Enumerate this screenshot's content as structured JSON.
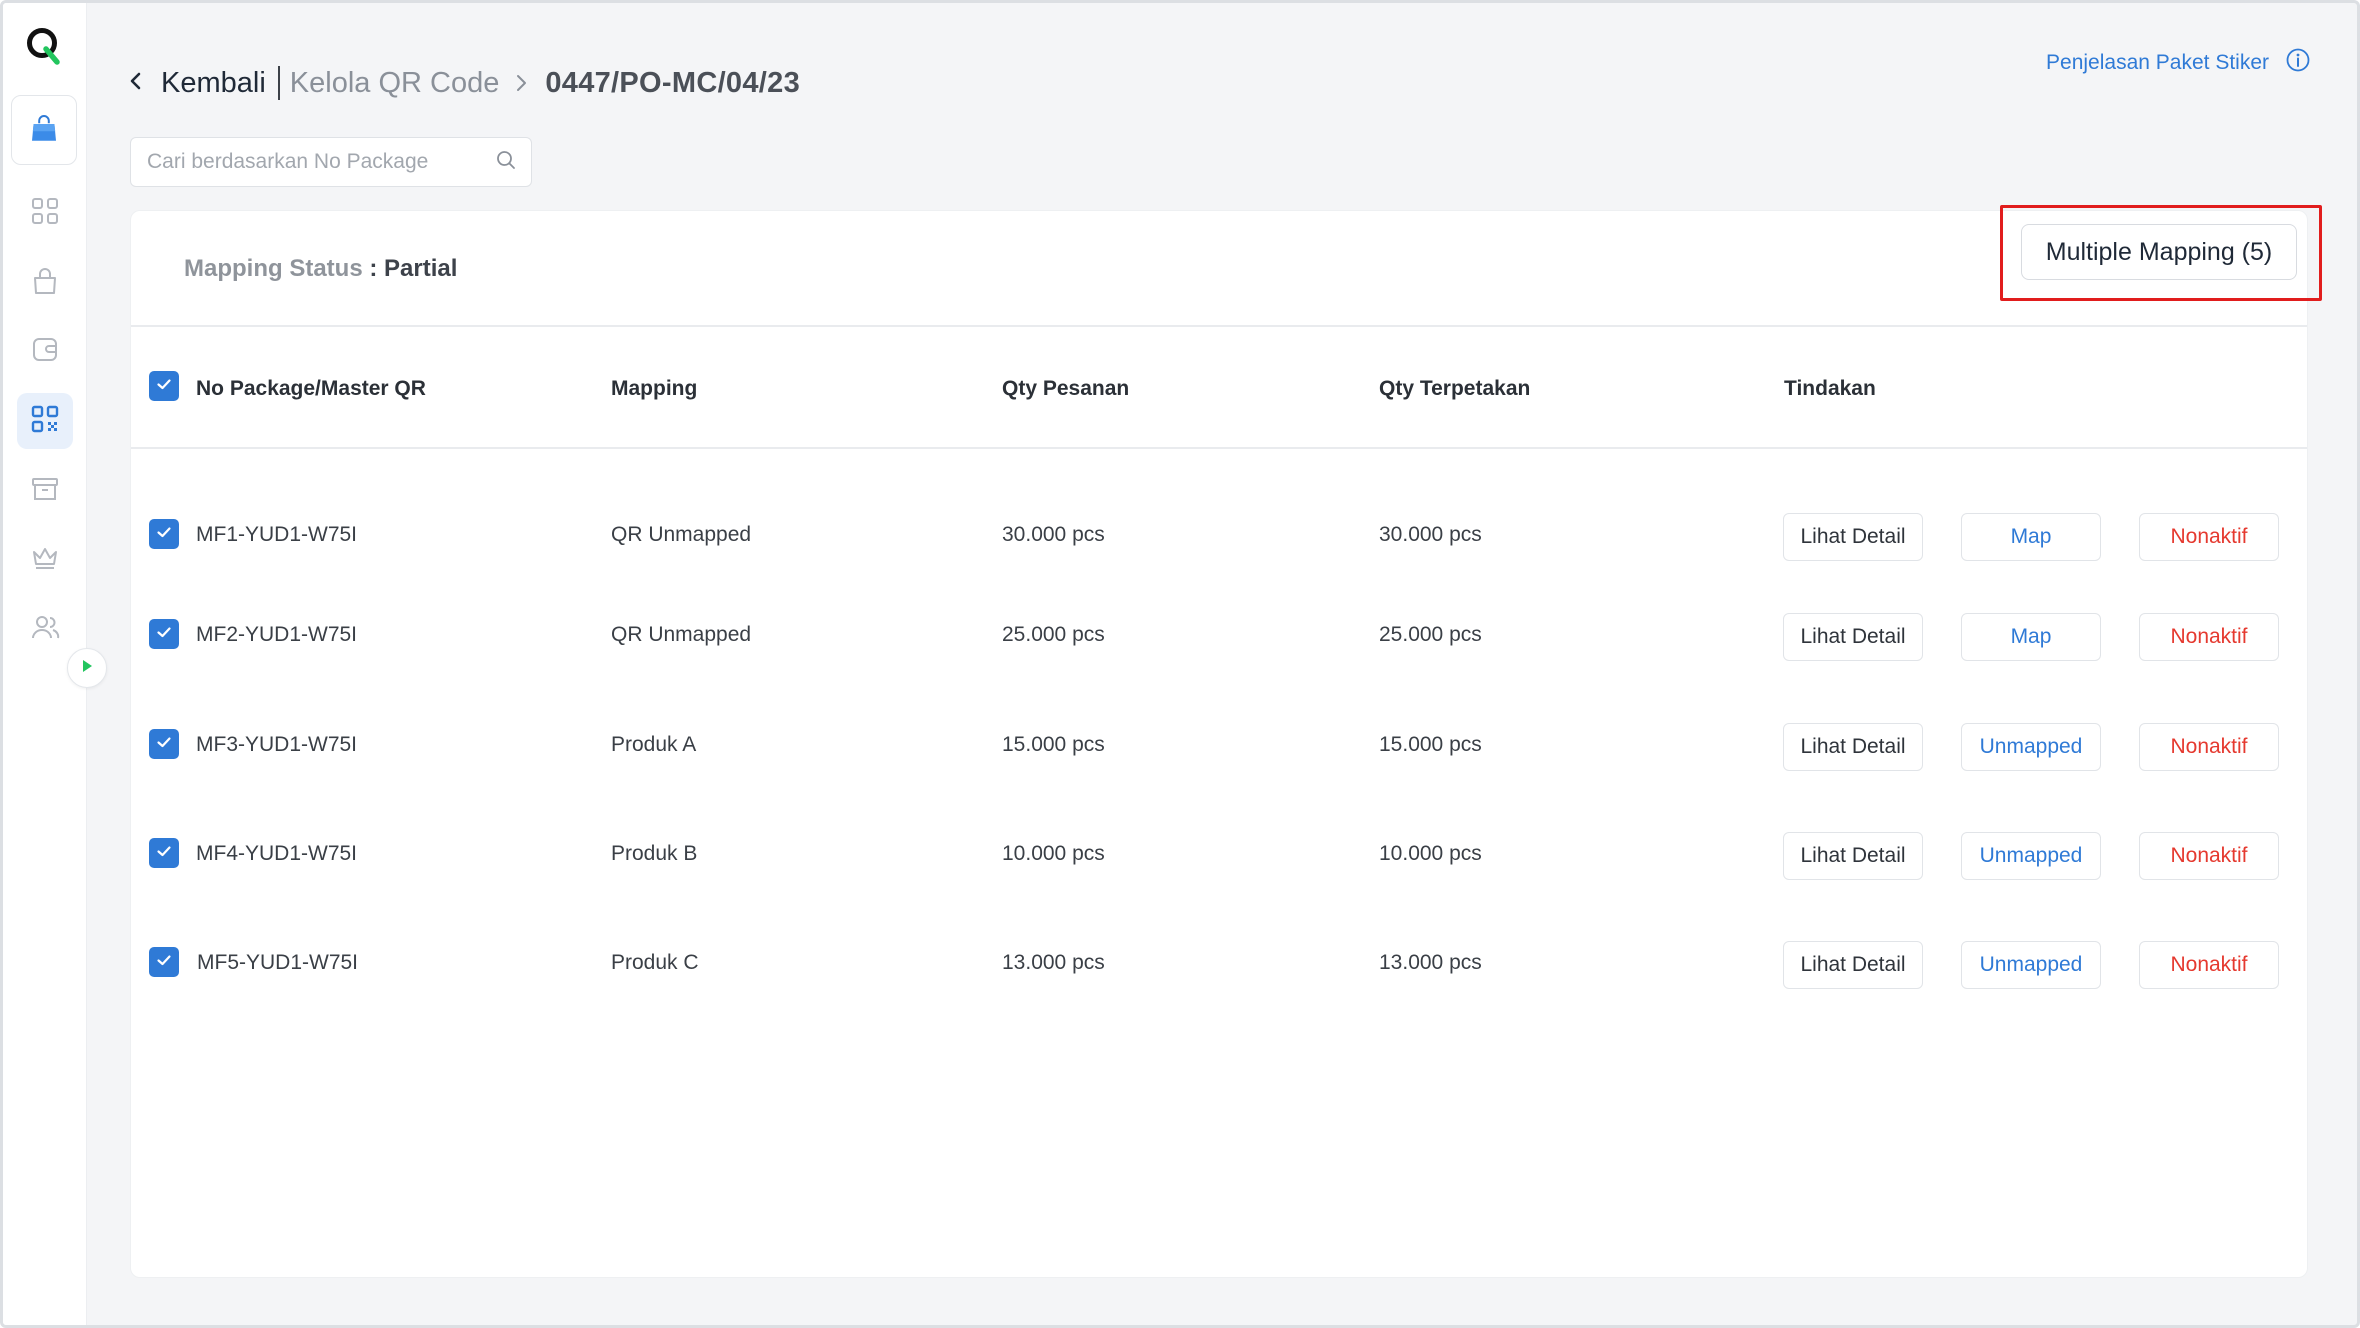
{
  "breadcrumb": {
    "back_label": "Kembali",
    "parent_label": "Kelola QR Code",
    "current_label": "0447/PO-MC/04/23"
  },
  "header": {
    "help_link_label": "Penjelasan Paket Stiker"
  },
  "search": {
    "placeholder": "Cari berdasarkan No Package",
    "value": ""
  },
  "status": {
    "label": "Mapping Status",
    "separator": " : ",
    "value": "Partial"
  },
  "toolbar": {
    "multiple_mapping_label": "Multiple Mapping (5)"
  },
  "table": {
    "columns": {
      "package": "No Package/Master QR",
      "mapping": "Mapping",
      "qty_order": "Qty Pesanan",
      "qty_printed": "Qty Terpetakan",
      "actions": "Tindakan"
    },
    "header_checked": true,
    "rows": [
      {
        "package": "MF1-YUD1-W75I",
        "mapping": "QR Unmapped",
        "qty_order": "30.000 pcs",
        "qty_printed": "30.000 pcs",
        "checked": true,
        "detail": "Lihat Detail",
        "map_action": "Map",
        "deactivate": "Nonaktif"
      },
      {
        "package": "MF2-YUD1-W75I",
        "mapping": "QR Unmapped",
        "qty_order": "25.000 pcs",
        "qty_printed": "25.000 pcs",
        "checked": true,
        "detail": "Lihat Detail",
        "map_action": "Map",
        "deactivate": "Nonaktif"
      },
      {
        "package": "MF3-YUD1-W75I",
        "mapping": "Produk A",
        "qty_order": "15.000 pcs",
        "qty_printed": "15.000 pcs",
        "checked": true,
        "detail": "Lihat Detail",
        "map_action": "Unmapped",
        "deactivate": "Nonaktif"
      },
      {
        "package": "MF4-YUD1-W75I",
        "mapping": "Produk B",
        "qty_order": "10.000 pcs",
        "qty_printed": "10.000 pcs",
        "checked": true,
        "detail": "Lihat Detail",
        "map_action": "Unmapped",
        "deactivate": "Nonaktif"
      },
      {
        "package": "MF5-YUD1-W75I",
        "mapping": "Produk C",
        "qty_order": "13.000 pcs",
        "qty_printed": "13.000 pcs",
        "checked": true,
        "detail": "Lihat Detail",
        "map_action": "Unmapped",
        "deactivate": "Nonaktif"
      }
    ]
  },
  "sidebar": {
    "items": [
      {
        "icon": "shopping-bag-icon",
        "active": true
      },
      {
        "icon": "dashboard-grid-icon",
        "active": false
      },
      {
        "icon": "bag-icon",
        "active": false
      },
      {
        "icon": "wallet-icon",
        "active": false
      },
      {
        "icon": "qr-code-icon",
        "active": true
      },
      {
        "icon": "archive-box-icon",
        "active": false
      },
      {
        "icon": "crown-icon",
        "active": false
      },
      {
        "icon": "users-icon",
        "active": false
      }
    ]
  },
  "colors": {
    "accent": "#2f7ad6",
    "danger": "#e5392f",
    "highlight": "#e11d1d",
    "brand_green": "#22c55e"
  }
}
